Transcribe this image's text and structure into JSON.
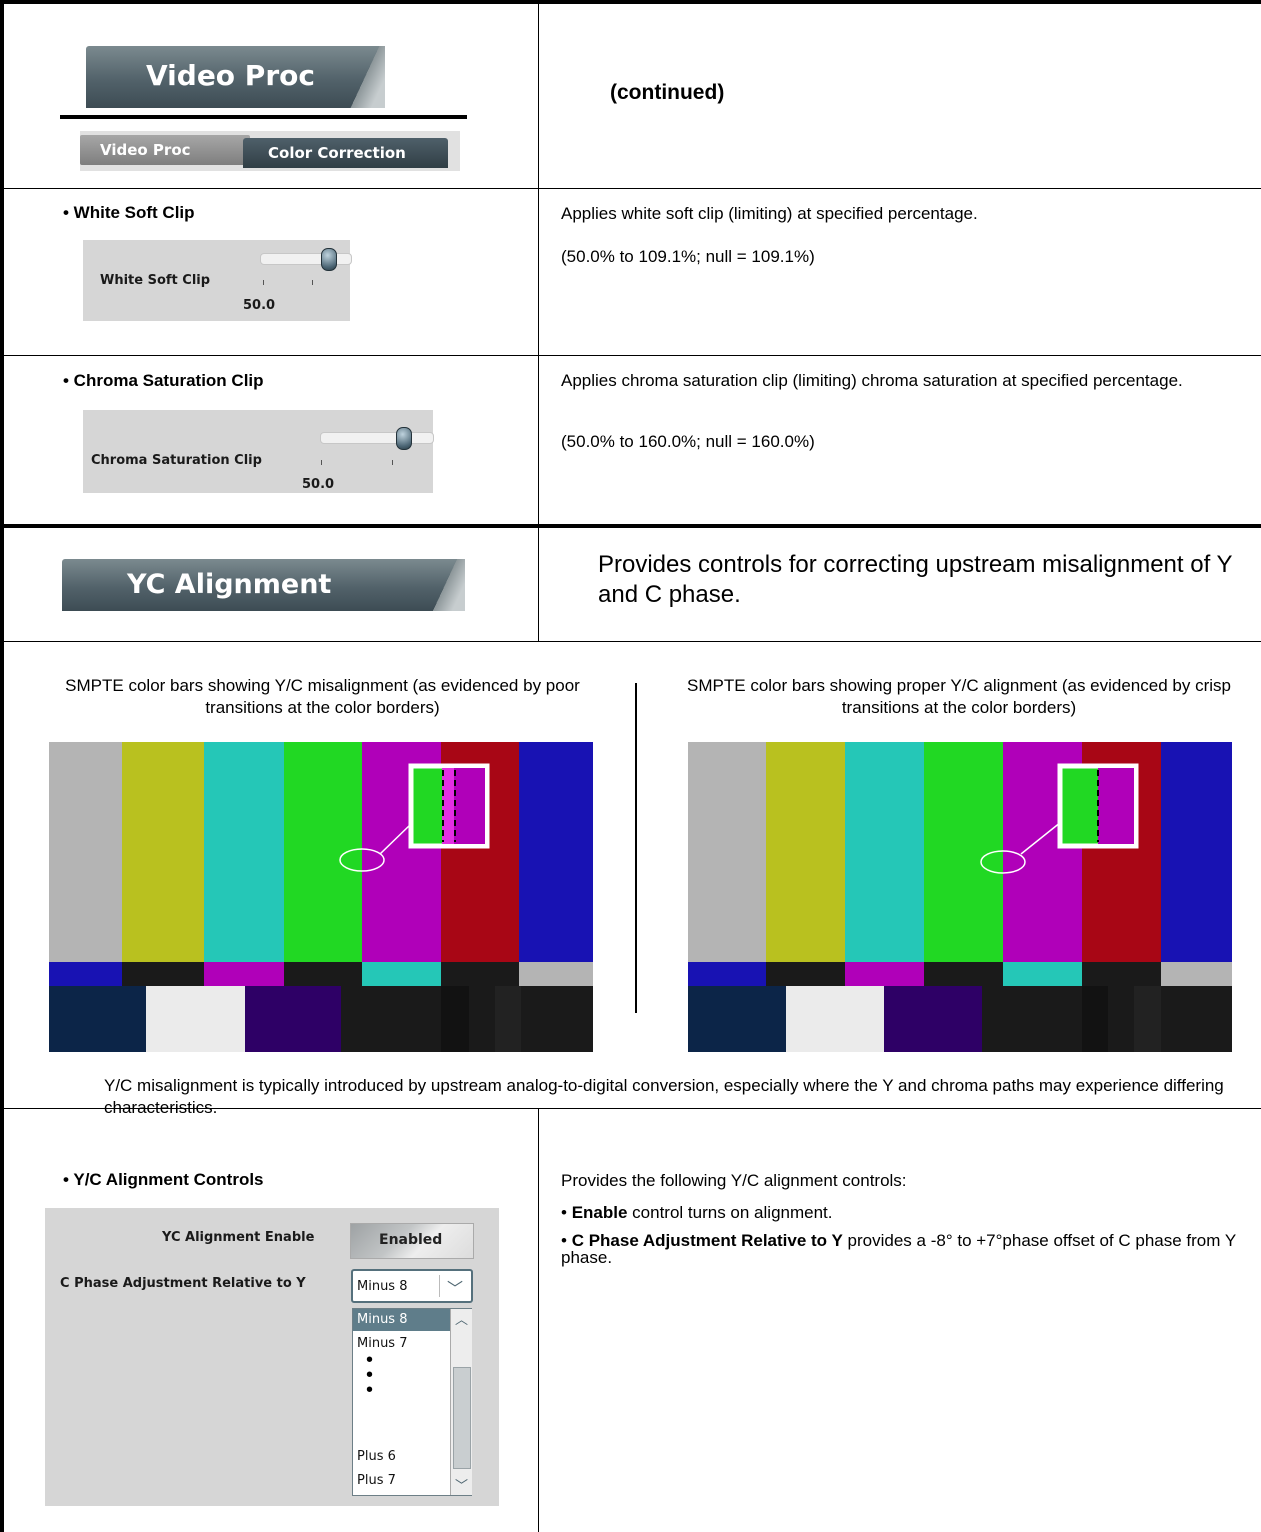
{
  "section1": {
    "main_tab": "Video Proc",
    "sub_tabs": [
      "Video Proc",
      "Color Correction"
    ],
    "continued": "(continued)"
  },
  "white_soft_clip": {
    "heading": "• White Soft Clip",
    "control_label": "White Soft Clip",
    "value": "50.0",
    "desc1": "Applies white soft clip (limiting) at specified percentage.",
    "desc2": "(50.0% to 109.1%; null = 109.1%)"
  },
  "chroma_clip": {
    "heading": "• Chroma Saturation Clip",
    "control_label": "Chroma Saturation Clip",
    "value": "50.0",
    "desc1": "Applies chroma saturation clip (limiting) chroma saturation at specified percentage.",
    "desc2": "(50.0% to 160.0%; null = 160.0%)"
  },
  "yc_alignment": {
    "tab": "YC Alignment",
    "desc": "Provides controls for correcting upstream misalignment of Y and C phase.",
    "caption_left": "SMPTE color bars showing Y/C misalignment (as evidenced by poor transitions at the color borders)",
    "caption_right": "SMPTE color bars showing proper Y/C alignment (as evidenced by crisp transitions at the color borders)",
    "note": "Y/C misalignment is typically introduced by upstream analog-to-digital conversion, especially where the Y and chroma paths may experience differing characteristics."
  },
  "yc_controls": {
    "heading": "• Y/C Alignment Controls",
    "enable_label": "YC Alignment Enable",
    "enable_value": "Enabled",
    "phase_label": "C Phase Adjustment Relative to Y",
    "phase_value": "Minus 8",
    "options": [
      "Minus 8",
      "Minus 7",
      "Plus 6",
      "Plus 7"
    ],
    "intro": "Provides the following Y/C alignment controls:",
    "bullet1_bold": "Enable",
    "bullet1_rest": " control turns on alignment.",
    "bullet2_bold": "C Phase Adjustment Relative to Y",
    "bullet2_rest": " provides a -8° to +7°phase offset of C phase from Y phase."
  },
  "colors": {
    "bar_gray": "#b4b4b4",
    "bar_yellow": "#b9c11f",
    "bar_cyan": "#25c7b7",
    "bar_green": "#21d823",
    "bar_magenta": "#b000b9",
    "bar_red": "#a80615",
    "bar_blue": "#1812b3"
  }
}
